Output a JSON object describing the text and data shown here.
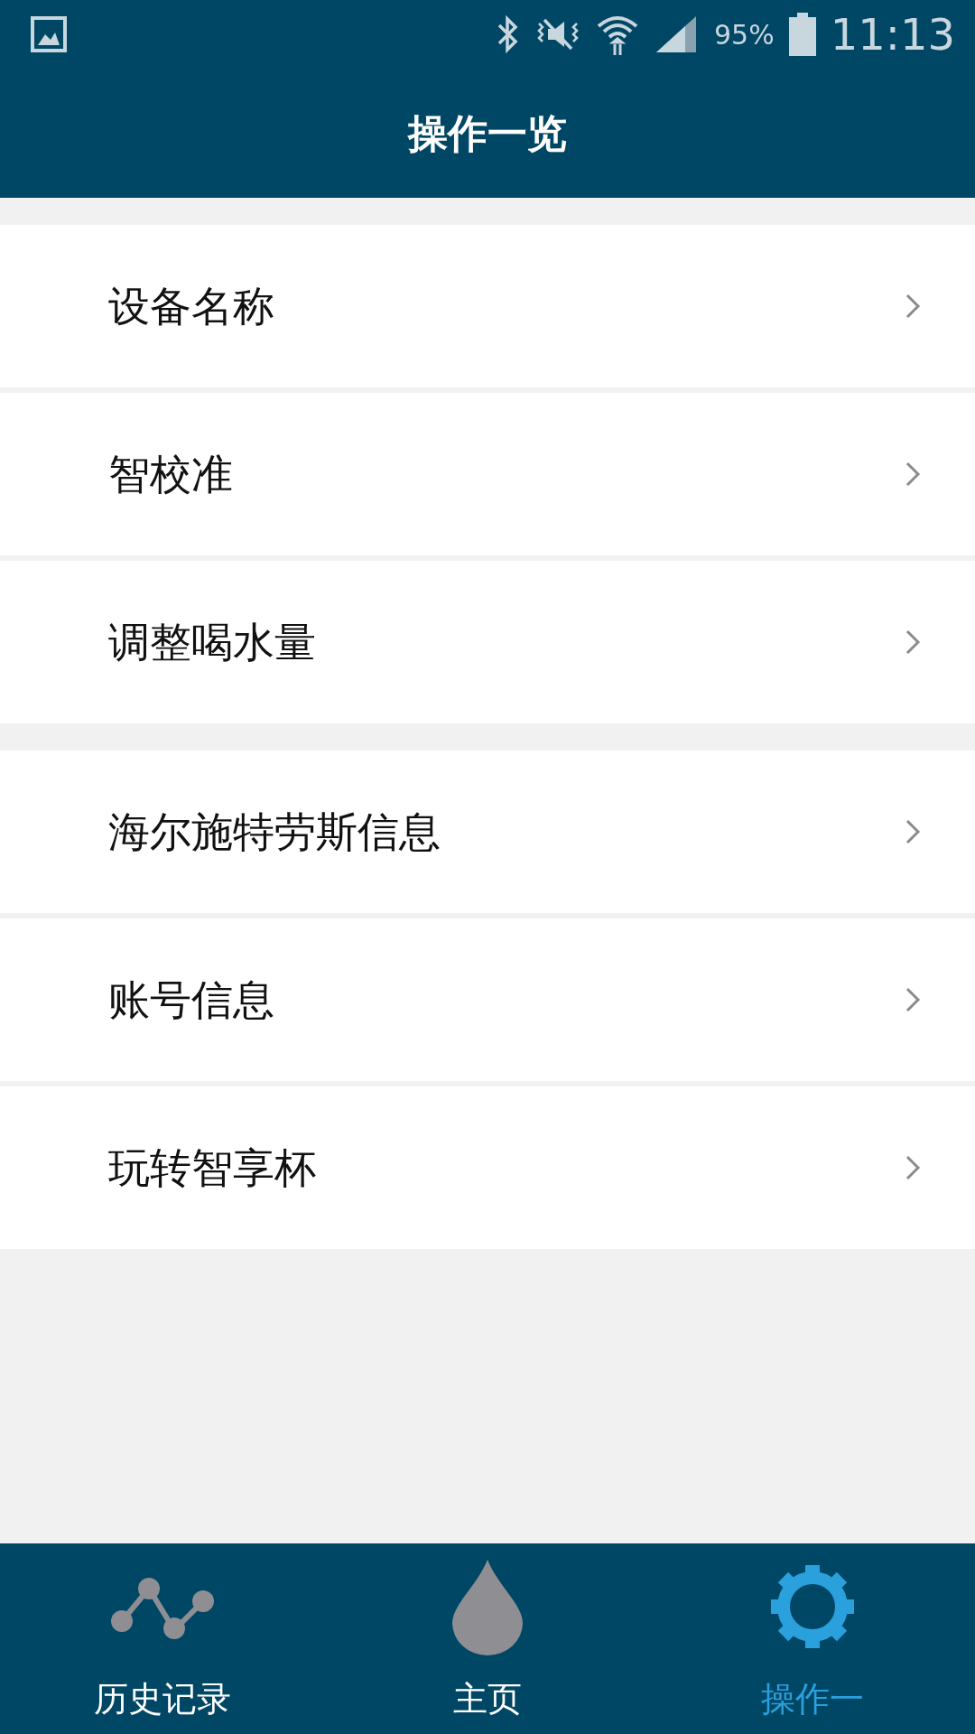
{
  "status_bar": {
    "battery": "95%",
    "time": "11:13"
  },
  "header": {
    "title": "操作一览"
  },
  "groups": [
    {
      "items": [
        {
          "label": "设备名称"
        },
        {
          "label": "智校准"
        },
        {
          "label": "调整喝水量"
        }
      ]
    },
    {
      "items": [
        {
          "label": "海尔施特劳斯信息"
        },
        {
          "label": "账号信息"
        },
        {
          "label": "玩转智享杯"
        }
      ]
    }
  ],
  "tabs": [
    {
      "label": "历史记录",
      "kind": "history",
      "selected": false
    },
    {
      "label": "主页",
      "kind": "home",
      "selected": false
    },
    {
      "label": "操作一",
      "kind": "settings",
      "selected": true
    }
  ]
}
